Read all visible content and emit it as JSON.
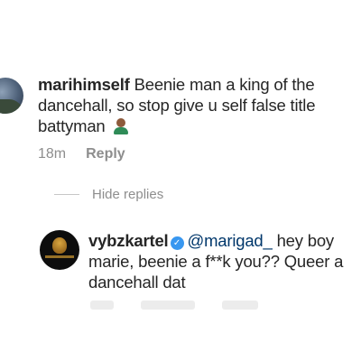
{
  "comment1": {
    "username": "marihimself",
    "text": "Beenie man a king of the dancehall, so stop give u self false title battyman",
    "emoji": "person-emoji",
    "time": "18m",
    "reply_label": "Reply"
  },
  "hide_replies_label": "Hide replies",
  "comment2": {
    "username": "vybzkartel",
    "verified": true,
    "mention": "@marigad_",
    "text": "hey boy marie, beenie a f**k you?? Queer a dancehall dat"
  }
}
